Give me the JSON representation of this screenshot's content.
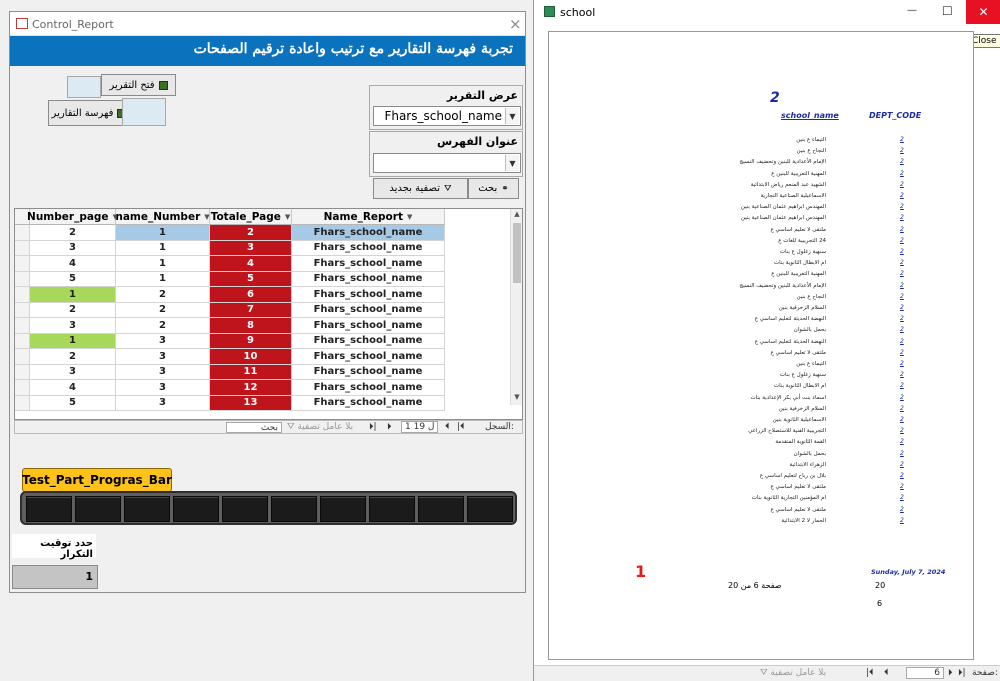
{
  "left_window": {
    "title": "Control_Report",
    "close_icon": "×",
    "banner": "تجربة فهرسة التقارير مع ترتيب واعادة ترقيم الصفحات",
    "open_report_btn": "فتح التقرير",
    "index_report_btn": "فهرسة التقارير",
    "report_label": "عرض التقرير",
    "report_combo_value": "Fhars_school_name",
    "index_label": "عنوان الفهرس",
    "index_combo_value": "",
    "search_btn": "بحث",
    "refilter_btn": "تصفية بجديد",
    "grid": {
      "headers": [
        "Number_page",
        "name_Number",
        "Totale_Page",
        "Name_Report"
      ],
      "rows": [
        [
          "2",
          "1",
          "2",
          "Fhars_school_name"
        ],
        [
          "3",
          "1",
          "3",
          "Fhars_school_name"
        ],
        [
          "4",
          "1",
          "4",
          "Fhars_school_name"
        ],
        [
          "5",
          "1",
          "5",
          "Fhars_school_name"
        ],
        [
          "1",
          "2",
          "6",
          "Fhars_school_name"
        ],
        [
          "2",
          "2",
          "7",
          "Fhars_school_name"
        ],
        [
          "3",
          "2",
          "8",
          "Fhars_school_name"
        ],
        [
          "1",
          "3",
          "9",
          "Fhars_school_name"
        ],
        [
          "2",
          "3",
          "10",
          "Fhars_school_name"
        ],
        [
          "3",
          "3",
          "11",
          "Fhars_school_name"
        ],
        [
          "4",
          "3",
          "12",
          "Fhars_school_name"
        ],
        [
          "5",
          "3",
          "13",
          "Fhars_school_name"
        ]
      ],
      "colors": {
        "red": "#c0141c",
        "green": "#a8d85a",
        "selected": "#a6c9e6"
      }
    },
    "nav": {
      "record_label": "السجل:",
      "record_pos": "1 ل 19",
      "no_filter": "بلا عامل تصفية",
      "search": "بحث"
    },
    "test_btn": "Test_Part_Progras_Bar",
    "repeat_label": "حدد توقيت التكرار",
    "repeat_value": "1"
  },
  "right_window": {
    "title": "school",
    "tooltip": "Close",
    "minimize_icon": "—",
    "maximize_icon": "☐",
    "close_icon": "✕",
    "report": {
      "big_num": "2",
      "col1": "school_name",
      "col2": "DEPT_CODE",
      "lines": [
        "التيماء ع بنين",
        "النجاح ع بنين",
        "الإمام الأعدادية للبنين وتحضيف النسيج",
        "المهنية التعريبية للبنين ع",
        "الشهيد عبد المنعم رياض الابتدائية",
        "الاسماعيلية الصناعية التجارية",
        "المهندس ابراهيم عثمان الصناعية بنين",
        "المهندس ابراهيم عثمان الصناعية بنين",
        "ملتقى لا تعليم اساسي ع",
        "24 التجريبية للغات ع",
        "سنهبة زغلول ع بنات",
        "ام الابطال الثانوية بنات",
        "المهنية التعريبية للبنين ع",
        "الإمام الأعدادية للبنين وتحضيف النسيج",
        "النجاح ع بنين",
        "السلام الزخرفية بنين",
        "النهضة الحديثة لتعليم اساسي ع",
        "بحمل بالشوان",
        "النهضة الحديثة لتعليم اساسي ع",
        "ملتقى لا تعليم اساسي ع",
        "التيماء ع بنين",
        "سنهبة زغلول ع بنات",
        "ام الابطال الثانوية بنات",
        "اسماء بنت أبي بكر الإعدادية بنات",
        "السلام الزخرفية بنين",
        "الاسماعيلية الثانوية بنين",
        "التجريبية الفنية للاستصلاح الزراعي",
        "القمة الثانوية المتقدمة",
        "بحمل بالشوان",
        "الزهراء الابتدائية",
        "بلال بن رباح لتعليم اساسي ع",
        "ملتقى لا تعليم اساسي ع",
        "ام المؤمنين التجارية الثانوية بنات",
        "ملتقى لا تعليم اساسي ع",
        "الحمار لا 2 الابتدائية"
      ],
      "dept_value": "2",
      "red_num": "1",
      "date": "Sunday, July 7, 2024",
      "page_text": "صفحة 6 من 20",
      "total": "20",
      "page_num": "6"
    },
    "nav": {
      "page_label": "صفحة:",
      "page_pos": "6",
      "no_filter": "بلا عامل تصفية"
    }
  }
}
